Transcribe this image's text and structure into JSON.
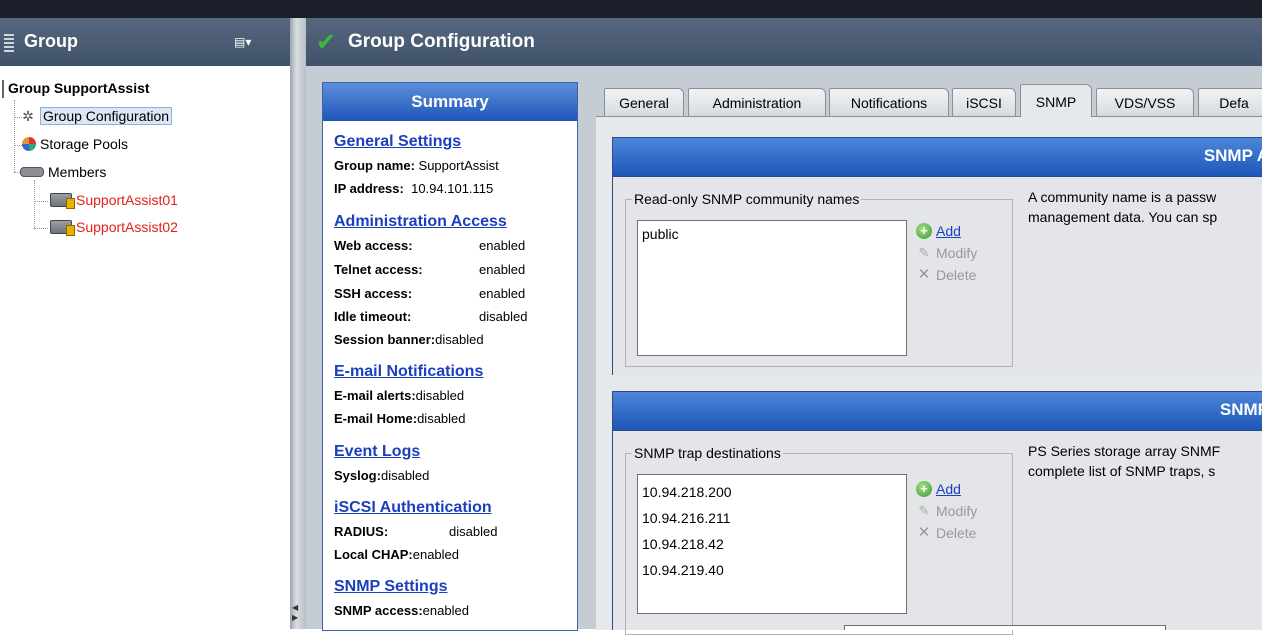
{
  "left": {
    "header_title": "Group",
    "tree": {
      "root": "Group SupportAssist",
      "items": [
        {
          "label": "Group Configuration",
          "icon": "gear-icon"
        },
        {
          "label": "Storage Pools",
          "icon": "storage-pool-icon"
        },
        {
          "label": "Members",
          "icon": "members-icon"
        }
      ],
      "members": [
        "SupportAssist01",
        "SupportAssist02"
      ]
    }
  },
  "main": {
    "title": "Group Configuration",
    "summary": {
      "title": "Summary",
      "general": {
        "title": "General Settings",
        "group_name_label": "Group name:",
        "group_name": "SupportAssist",
        "ip_label": "IP address:",
        "ip": "10.94.101.115"
      },
      "admin": {
        "title": "Administration Access",
        "web_label": "Web access:",
        "web": "enabled",
        "telnet_label": "Telnet access:",
        "telnet": "enabled",
        "ssh_label": "SSH access:",
        "ssh": "enabled",
        "idle_label": "Idle timeout:",
        "idle": "disabled",
        "banner_label": "Session banner:",
        "banner": "disabled"
      },
      "email": {
        "title": "E-mail Notifications",
        "alerts_label": "E-mail alerts:",
        "alerts": "disabled",
        "home_label": "E-mail Home:",
        "home": "disabled"
      },
      "event": {
        "title": "Event Logs",
        "syslog_label": "Syslog:",
        "syslog": "disabled"
      },
      "iscsi": {
        "title": "iSCSI Authentication",
        "radius_label": "RADIUS:",
        "radius": "disabled",
        "chap_label": "Local CHAP:",
        "chap": "enabled"
      },
      "snmp": {
        "title": "SNMP Settings",
        "access_label": "SNMP access:",
        "access": "enabled"
      }
    },
    "tabs": [
      "General",
      "Administration",
      "Notifications",
      "iSCSI",
      "SNMP",
      "VDS/VSS",
      "Defa"
    ],
    "active_tab": "SNMP",
    "snmp_access": {
      "header": "SNMP A",
      "group_label": "Read-only SNMP community names",
      "communities": [
        "public"
      ],
      "add": "Add",
      "modify": "Modify",
      "delete": "Delete",
      "desc_line1": "A community name is a passw",
      "desc_line2": "management data. You can sp"
    },
    "snmp_traps": {
      "header": "SNMP",
      "group_label": "SNMP trap destinations",
      "destinations": [
        "10.94.218.200",
        "10.94.216.211",
        "10.94.218.42",
        "10.94.219.40"
      ],
      "add": "Add",
      "modify": "Modify",
      "delete": "Delete",
      "desc_line1": "PS Series storage array SNMF",
      "desc_line2": "complete list of SNMP traps, s"
    }
  },
  "colors": {
    "header_bg": "#4a5b74",
    "summary_head": "#2a62c4",
    "link": "#1b3fbd",
    "member_text": "#e0201a",
    "check": "#3cb83c"
  }
}
